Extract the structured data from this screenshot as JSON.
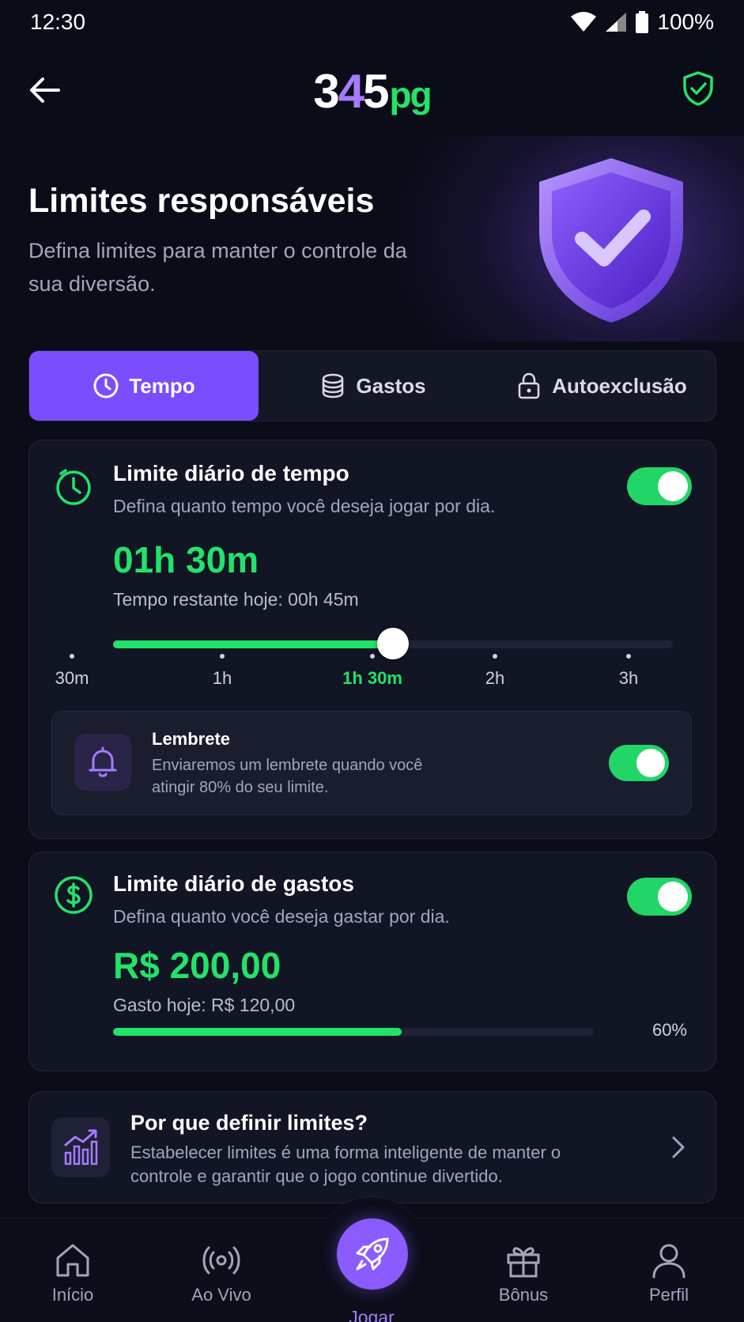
{
  "status": {
    "time": "12:30",
    "battery": "100%"
  },
  "header": {
    "logo": {
      "d1": "3",
      "d2": "4",
      "d3": "5",
      "pg": "pg"
    }
  },
  "hero": {
    "title": "Limites responsáveis",
    "subtitle": "Defina limites para manter o controle da sua diversão."
  },
  "tabs": [
    {
      "label": "Tempo",
      "icon": "clock-icon",
      "active": true
    },
    {
      "label": "Gastos",
      "icon": "coins-icon",
      "active": false
    },
    {
      "label": "Autoexclusão",
      "icon": "lock-icon",
      "active": false
    }
  ],
  "time_limit": {
    "title": "Limite diário de tempo",
    "description": "Defina quanto tempo você deseja jogar por dia.",
    "value": "01h 30m",
    "remaining": "Tempo restante hoje: 00h 45m",
    "enabled": true,
    "slider_position": 0.5,
    "ticks": [
      "30m",
      "1h",
      "1h 30m",
      "2h",
      "3h"
    ],
    "active_tick": "1h 30m"
  },
  "reminder": {
    "title": "Lembrete",
    "text": "Enviaremos um lembrete quando você atingir 80% do seu limite.",
    "enabled": true
  },
  "spend_limit": {
    "title": "Limite diário de gastos",
    "description": "Defina quanto você deseja gastar por dia.",
    "value": "R$ 200,00",
    "spent_today": "Gasto hoje: R$ 120,00",
    "enabled": true,
    "progress": 0.6,
    "progress_label": "60%"
  },
  "info": {
    "title": "Por que definir limites?",
    "text": "Estabelecer limites é uma forma inteligente de manter o controle e garantir que o jogo continue divertido."
  },
  "nav": [
    {
      "label": "Início",
      "icon": "home-icon"
    },
    {
      "label": "Ao Vivo",
      "icon": "live-icon"
    },
    {
      "label": "Jogar",
      "icon": "rocket-icon",
      "active": true
    },
    {
      "label": "Bônus",
      "icon": "gift-icon"
    },
    {
      "label": "Perfil",
      "icon": "user-icon"
    }
  ],
  "colors": {
    "accent_purple": "#7a4dff",
    "accent_green": "#22e36a",
    "background": "#0a0c17"
  }
}
